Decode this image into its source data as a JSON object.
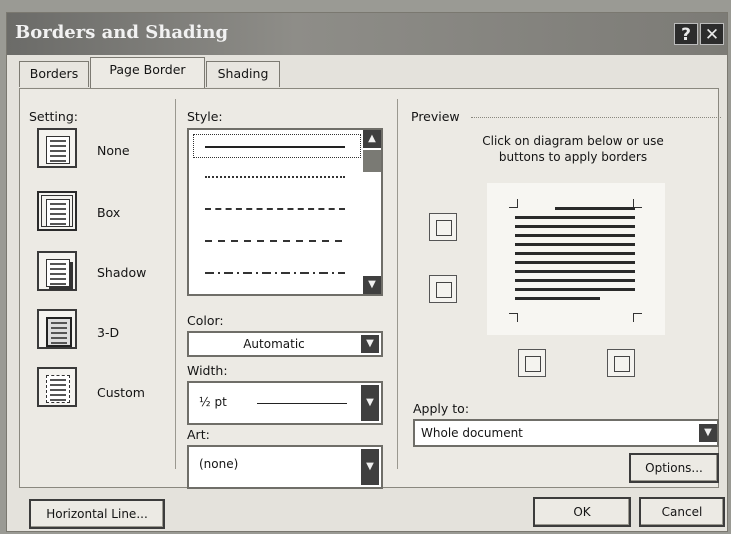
{
  "title": "Borders and Shading",
  "title_buttons": {
    "help": "?",
    "close": "✕"
  },
  "tabs": [
    "Borders",
    "Page Border",
    "Shading"
  ],
  "setting": {
    "label": "Setting:",
    "options": [
      "None",
      "Box",
      "Shadow",
      "3-D",
      "Custom"
    ]
  },
  "style": {
    "label": "Style:",
    "line_styles": [
      "solid",
      "dotted",
      "dashed-dense",
      "dashed",
      "dash-dot"
    ]
  },
  "color": {
    "label": "Color:",
    "value": "Automatic"
  },
  "width": {
    "label": "Width:",
    "value": "½ pt"
  },
  "art": {
    "label": "Art:",
    "value": "(none)"
  },
  "preview": {
    "label": "Preview",
    "instruction": "Click on diagram below or use buttons to apply borders"
  },
  "apply_to": {
    "label": "Apply to:",
    "value": "Whole document"
  },
  "buttons": {
    "options": "Options...",
    "horizontal_line": "Horizontal Line...",
    "ok": "OK",
    "cancel": "Cancel"
  }
}
